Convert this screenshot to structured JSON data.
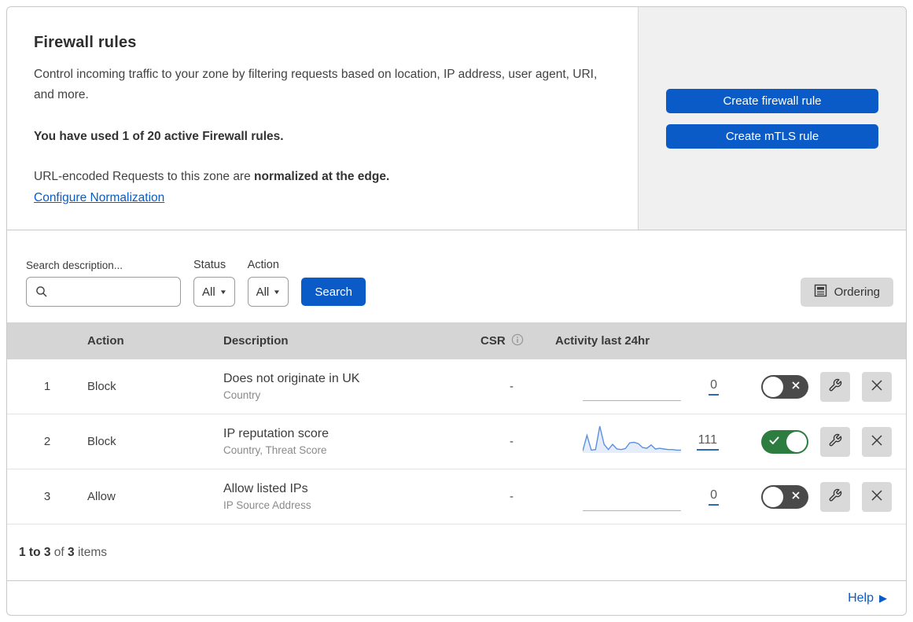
{
  "header": {
    "title": "Firewall rules",
    "description": "Control incoming traffic to your zone by filtering requests based on location, IP address, user agent, URI, and more.",
    "usage_text": "You have used 1 of 20 active Firewall rules.",
    "normalization_text": "URL-encoded Requests to this zone are ",
    "normalization_bold": "normalized at the edge.",
    "normalization_link": "Configure Normalization",
    "create_firewall_button": "Create firewall rule",
    "create_mtls_button": "Create mTLS rule"
  },
  "filters": {
    "search_label": "Search description...",
    "search_value": "",
    "status_label": "Status",
    "status_value": "All",
    "action_label": "Action",
    "action_value": "All",
    "search_button": "Search",
    "ordering_button": "Ordering"
  },
  "table": {
    "columns": {
      "action": "Action",
      "description": "Description",
      "csr": "CSR",
      "activity": "Activity last 24hr"
    },
    "rows": [
      {
        "index": "1",
        "action": "Block",
        "description": "Does not originate in UK",
        "fields": "Country",
        "csr": "-",
        "activity_count": "0",
        "enabled": false
      },
      {
        "index": "2",
        "action": "Block",
        "description": "IP reputation score",
        "fields": "Country, Threat Score",
        "csr": "-",
        "activity_count": "111",
        "enabled": true
      },
      {
        "index": "3",
        "action": "Allow",
        "description": "Allow listed IPs",
        "fields": "IP Source Address",
        "csr": "-",
        "activity_count": "0",
        "enabled": false
      }
    ]
  },
  "footer": {
    "range_bold": "1 to 3",
    "of_text": " of ",
    "total_bold": "3",
    "items_text": " items",
    "help_link": "Help"
  },
  "colors": {
    "primary_blue": "#0a5bc8",
    "link_blue": "#0a5bc8",
    "toggle_on_green": "#2e7d40",
    "toggle_off_gray": "#4a4a4a",
    "table_header_gray": "#d5d5d5",
    "panel_gray": "#f0f0f0",
    "button_gray": "#d9d9d9",
    "sparkline_blue": "#5b8fe0",
    "count_underline_blue": "#2a6cb8"
  },
  "chart_data": {
    "type": "area",
    "title": "Activity last 24hr sparkline (rule 2)",
    "x_range": "last 24 hours",
    "values": [
      5,
      65,
      8,
      10,
      100,
      30,
      10,
      30,
      12,
      10,
      14,
      36,
      38,
      33,
      18,
      15,
      28,
      12,
      15,
      12,
      10,
      10,
      8,
      8
    ],
    "total_shown": 111,
    "ylim": [
      0,
      100
    ],
    "grid": false
  }
}
